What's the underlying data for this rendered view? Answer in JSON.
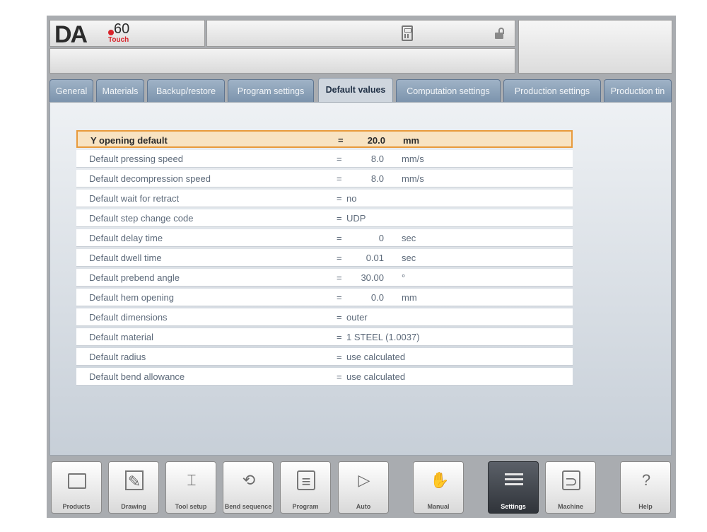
{
  "header": {
    "logo_brand": "DA",
    "logo_model": "60",
    "logo_sub": "Touch"
  },
  "tabs": [
    {
      "label": "General"
    },
    {
      "label": "Materials"
    },
    {
      "label": "Backup/restore"
    },
    {
      "label": "Program settings"
    },
    {
      "label": "Default values"
    },
    {
      "label": "Computation settings"
    },
    {
      "label": "Production settings"
    },
    {
      "label": "Production tin"
    }
  ],
  "active_tab": "Default values",
  "settings": [
    {
      "label": "Y opening default",
      "eq": "=",
      "value": "20.0",
      "unit": "mm"
    },
    {
      "label": "Default pressing speed",
      "eq": "=",
      "value": "8.0",
      "unit": "mm/s"
    },
    {
      "label": "Default decompression speed",
      "eq": "=",
      "value": "8.0",
      "unit": "mm/s"
    },
    {
      "label": "Default wait for retract",
      "eq": "=",
      "text": "no"
    },
    {
      "label": "Default step change code",
      "eq": "=",
      "text": "UDP"
    },
    {
      "label": "Default delay time",
      "eq": "=",
      "value": "0",
      "unit": "sec"
    },
    {
      "label": "Default dwell time",
      "eq": "=",
      "value": "0.01",
      "unit": "sec"
    },
    {
      "label": "Default prebend angle",
      "eq": "=",
      "value": "30.00",
      "unit": "°"
    },
    {
      "label": "Default hem opening",
      "eq": "=",
      "value": "0.0",
      "unit": "mm"
    },
    {
      "label": "Default dimensions",
      "eq": "=",
      "text": "outer"
    },
    {
      "label": "Default material",
      "eq": "=",
      "text": "1 STEEL (1.0037)"
    },
    {
      "label": "Default radius",
      "eq": "=",
      "text": "use calculated"
    },
    {
      "label": "Default bend allowance",
      "eq": "=",
      "text": "use calculated"
    }
  ],
  "toolbar": [
    {
      "label": "Products",
      "icon": "folder-icon"
    },
    {
      "label": "Drawing",
      "icon": "drawing-icon"
    },
    {
      "label": "Tool setup",
      "icon": "tool-setup-icon"
    },
    {
      "label": "Bend sequence",
      "icon": "bend-sequence-icon"
    },
    {
      "label": "Program",
      "icon": "program-icon"
    },
    {
      "label": "Auto",
      "icon": "play-icon"
    },
    {
      "label": "Manual",
      "icon": "hand-icon"
    },
    {
      "label": "Settings",
      "icon": "settings-list-icon"
    },
    {
      "label": "Machine",
      "icon": "machine-icon"
    },
    {
      "label": "Help",
      "icon": "help-icon"
    }
  ],
  "active_toolbar": "Settings"
}
